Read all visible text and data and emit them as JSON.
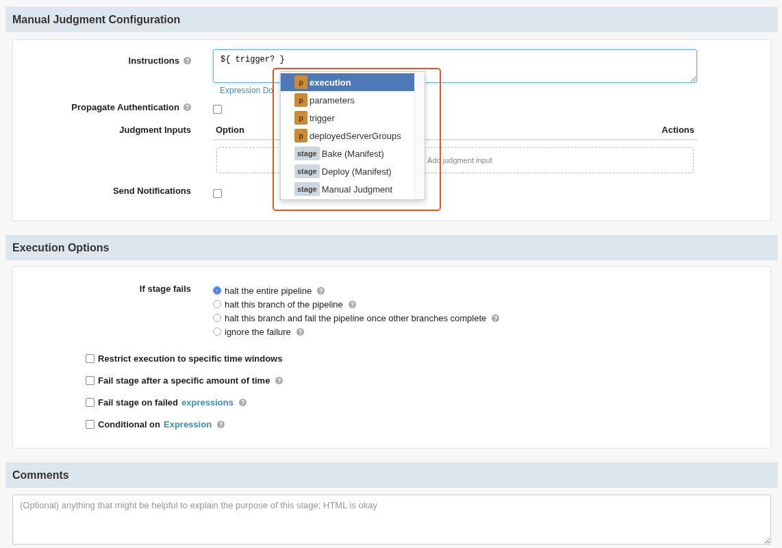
{
  "judgment_section": {
    "title": "Manual Judgment Configuration",
    "instructions": {
      "label": "Instructions",
      "value": "${ trigger? }",
      "docs_link": "Expression Do"
    },
    "propagate_authentication": {
      "label": "Propagate Authentication",
      "checked": false
    },
    "judgment_inputs": {
      "label": "Judgment Inputs",
      "columns": [
        "Option",
        "Actions"
      ],
      "add_button": "Add judgment input"
    },
    "send_notifications": {
      "label": "Send Notifications",
      "checked": false
    },
    "autocomplete": [
      {
        "kind": "property",
        "badge": "p",
        "label": "execution",
        "selected": true
      },
      {
        "kind": "property",
        "badge": "p",
        "label": "parameters",
        "selected": false
      },
      {
        "kind": "property",
        "badge": "p",
        "label": "trigger",
        "selected": false
      },
      {
        "kind": "property",
        "badge": "p",
        "label": "deployedServerGroups",
        "selected": false
      },
      {
        "kind": "stage",
        "badge": "stage",
        "label": "Bake (Manifest)",
        "selected": false
      },
      {
        "kind": "stage",
        "badge": "stage",
        "label": "Deploy (Manifest)",
        "selected": false
      },
      {
        "kind": "stage",
        "badge": "stage",
        "label": "Manual Judgment",
        "selected": false
      }
    ]
  },
  "execution_section": {
    "title": "Execution Options",
    "fail_label": "If stage fails",
    "fail_options": [
      {
        "label": "halt the entire pipeline",
        "selected": true
      },
      {
        "label": "halt this branch of the pipeline",
        "selected": false
      },
      {
        "label": "halt this branch and fail the pipeline once other branches complete",
        "selected": false
      },
      {
        "label": "ignore the failure",
        "selected": false
      }
    ],
    "options": [
      {
        "label": "Restrict execution to specific time windows",
        "checked": false,
        "help": false
      },
      {
        "label": "Fail stage after a specific amount of time",
        "checked": false,
        "help": true
      },
      {
        "label": "Fail stage on failed",
        "link": "expressions",
        "checked": false,
        "help": true
      },
      {
        "label": "Conditional on",
        "link": "Expression",
        "checked": false,
        "help": true
      }
    ]
  },
  "comments_section": {
    "title": "Comments",
    "placeholder": "(Optional) anything that might be helpful to explain the purpose of this stage; HTML is okay"
  }
}
